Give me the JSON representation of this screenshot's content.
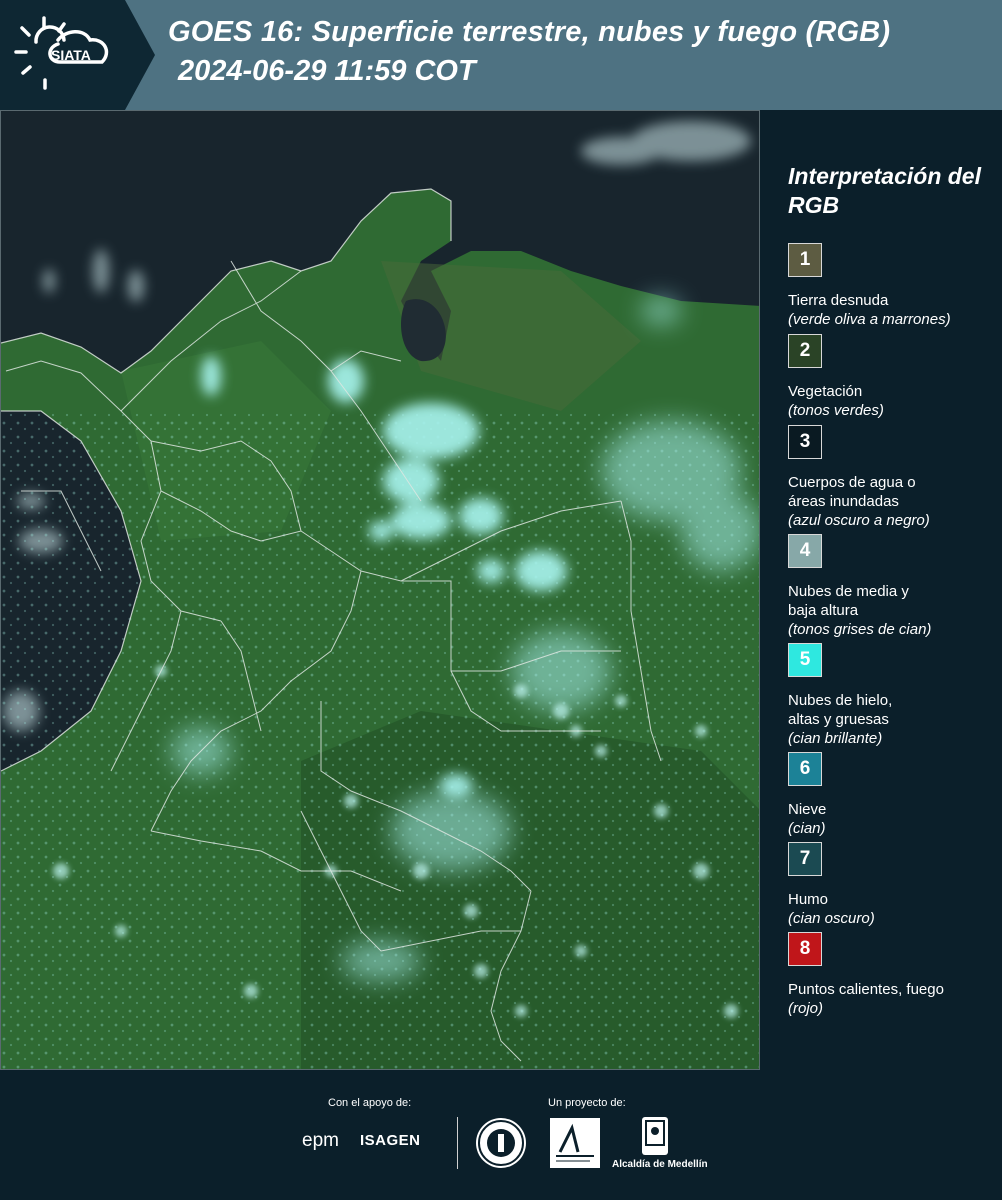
{
  "header": {
    "logo_text": "SIATA",
    "title": "GOES 16: Superficie terrestre, nubes y fuego (RGB)",
    "datetime": "2024-06-29 11:59 COT"
  },
  "legend": {
    "title": "Interpretación del RGB",
    "items": [
      {
        "number": "1",
        "label": "Tierra desnuda",
        "note": "(verde oliva a marrones)",
        "color": "#5d5c42",
        "text_color": "#ffffff"
      },
      {
        "number": "2",
        "label": "Vegetación",
        "note": "(tonos verdes)",
        "color": "#2a4326",
        "text_color": "#ffffff"
      },
      {
        "number": "3",
        "label": "Cuerpos de agua o áreas inundadas",
        "note": "(azul oscuro a negro)",
        "color": "#0a1a22",
        "text_color": "#ffffff"
      },
      {
        "number": "4",
        "label": "Nubes de media y baja altura",
        "note": "(tonos grises de cian)",
        "color": "#87a8a8",
        "text_color": "#ffffff"
      },
      {
        "number": "5",
        "label": "Nubes de hielo, altas y gruesas",
        "note": "(cian brillante)",
        "color": "#2ee8e0",
        "text_color": "#ffffff"
      },
      {
        "number": "6",
        "label": "Nieve",
        "note": "(cian)",
        "color": "#1c8297",
        "text_color": "#ffffff"
      },
      {
        "number": "7",
        "label": "Humo",
        "note": "(cian oscuro)",
        "color": "#1b4a52",
        "text_color": "#ffffff"
      },
      {
        "number": "8",
        "label": "Puntos calientes, fuego",
        "note": "(rojo)",
        "color": "#c0161a",
        "text_color": "#ffffff"
      }
    ]
  },
  "footer": {
    "support_label": "Con el apoyo de:",
    "project_label": "Un proyecto de:",
    "sponsor_epm": "epm",
    "sponsor_isagen": "ISAGEN",
    "partner_alcaldia": "Alcaldía de Medellín"
  },
  "map": {
    "description_colors": {
      "ocean": "#18252d",
      "land": "#2f6b33",
      "cloud": "#9ef0ec",
      "borders": "#dfe7e2"
    }
  }
}
